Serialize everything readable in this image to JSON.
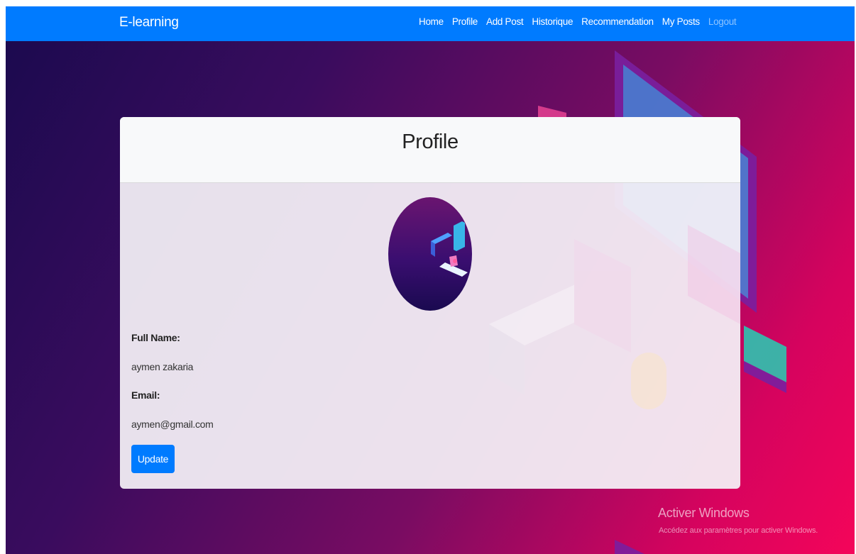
{
  "navbar": {
    "brand": "E-learning",
    "links": [
      "Home",
      "Profile",
      "Add Post",
      "Historique",
      "Recommendation",
      "My Posts",
      "Logout"
    ]
  },
  "card": {
    "title": "Profile",
    "full_name_label": "Full Name:",
    "full_name_value": "aymen zakaria",
    "email_label": "Email:",
    "email_value": "aymen@gmail.com",
    "update_label": "Update"
  },
  "watermark": {
    "title": "Activer Windows",
    "subtitle": "Accédez aux paramètres pour activer Windows."
  },
  "colors": {
    "primary": "#007bff",
    "background_start": "#1a0a4e",
    "background_end": "#f4055a"
  }
}
